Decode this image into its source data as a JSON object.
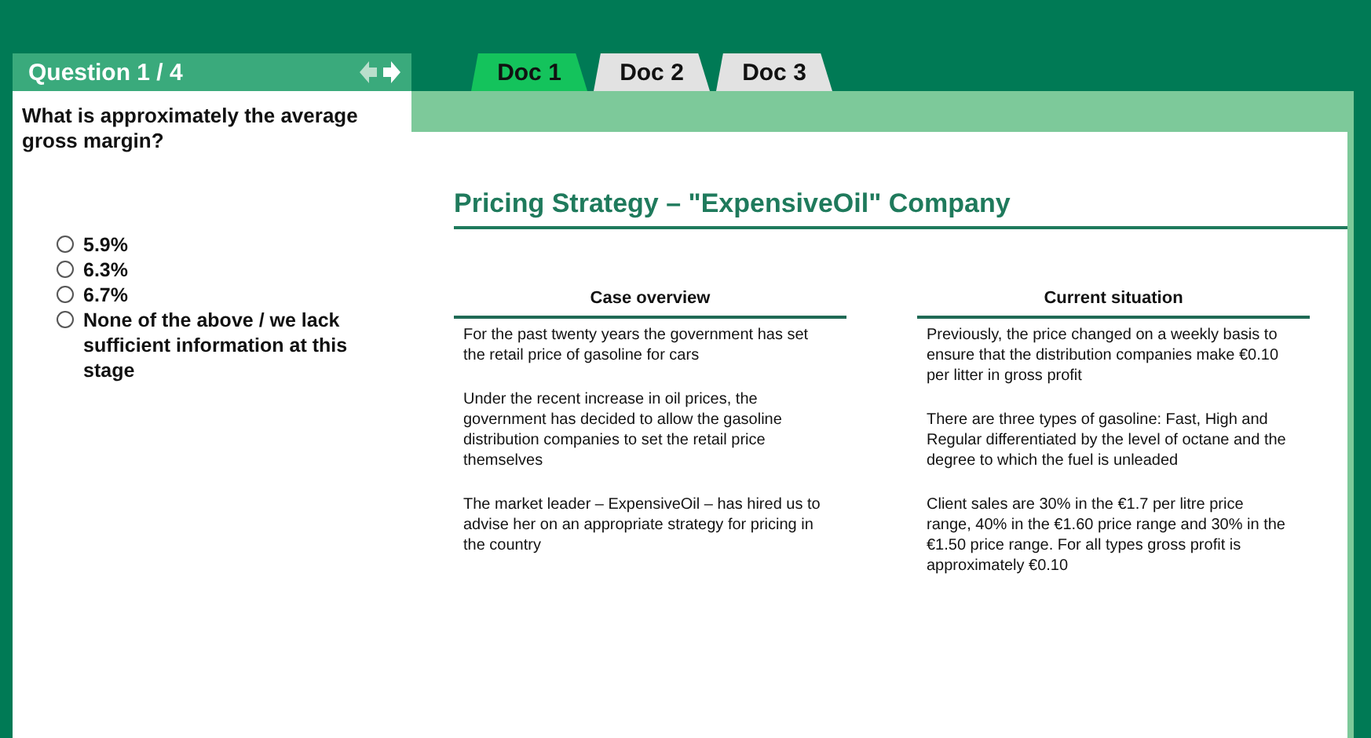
{
  "question": {
    "title": "Question 1 / 4",
    "text": "What is approximately the average gross margin?",
    "options": [
      {
        "label": "5.9%",
        "selected": false
      },
      {
        "label": "6.3%",
        "selected": false
      },
      {
        "label": "6.7%",
        "selected": false
      },
      {
        "label": "None of the above / we lack sufficient information at this stage",
        "selected": false
      }
    ]
  },
  "tabs": [
    {
      "label": "Doc 1",
      "selected": true
    },
    {
      "label": "Doc 2",
      "selected": false
    },
    {
      "label": "Doc 3",
      "selected": false
    }
  ],
  "document": {
    "title": "Pricing Strategy – \"ExpensiveOil\" Company",
    "columns": [
      {
        "heading": "Case overview",
        "paragraphs": [
          "For the past twenty years the government has set the retail price of gasoline for cars",
          "Under the recent increase in oil prices, the government has decided to allow the gasoline distribution companies to set the retail price themselves",
          "The market leader – ExpensiveOil – has hired us to advise her on an appropriate strategy for pricing in the country"
        ]
      },
      {
        "heading": "Current situation",
        "paragraphs": [
          "Previously, the price changed on a weekly basis to ensure that the distribution companies make €0.10 per litter in gross profit",
          "There are three types of gasoline: Fast, High and Regular differentiated by the level of octane and the degree to which the fuel is unleaded",
          "Client sales are 30% in the €1.7 per litre price range, 40% in the €1.60 price range and 30% in the €1.50 price range. For all types gross profit is approximately €0.10"
        ]
      }
    ]
  }
}
